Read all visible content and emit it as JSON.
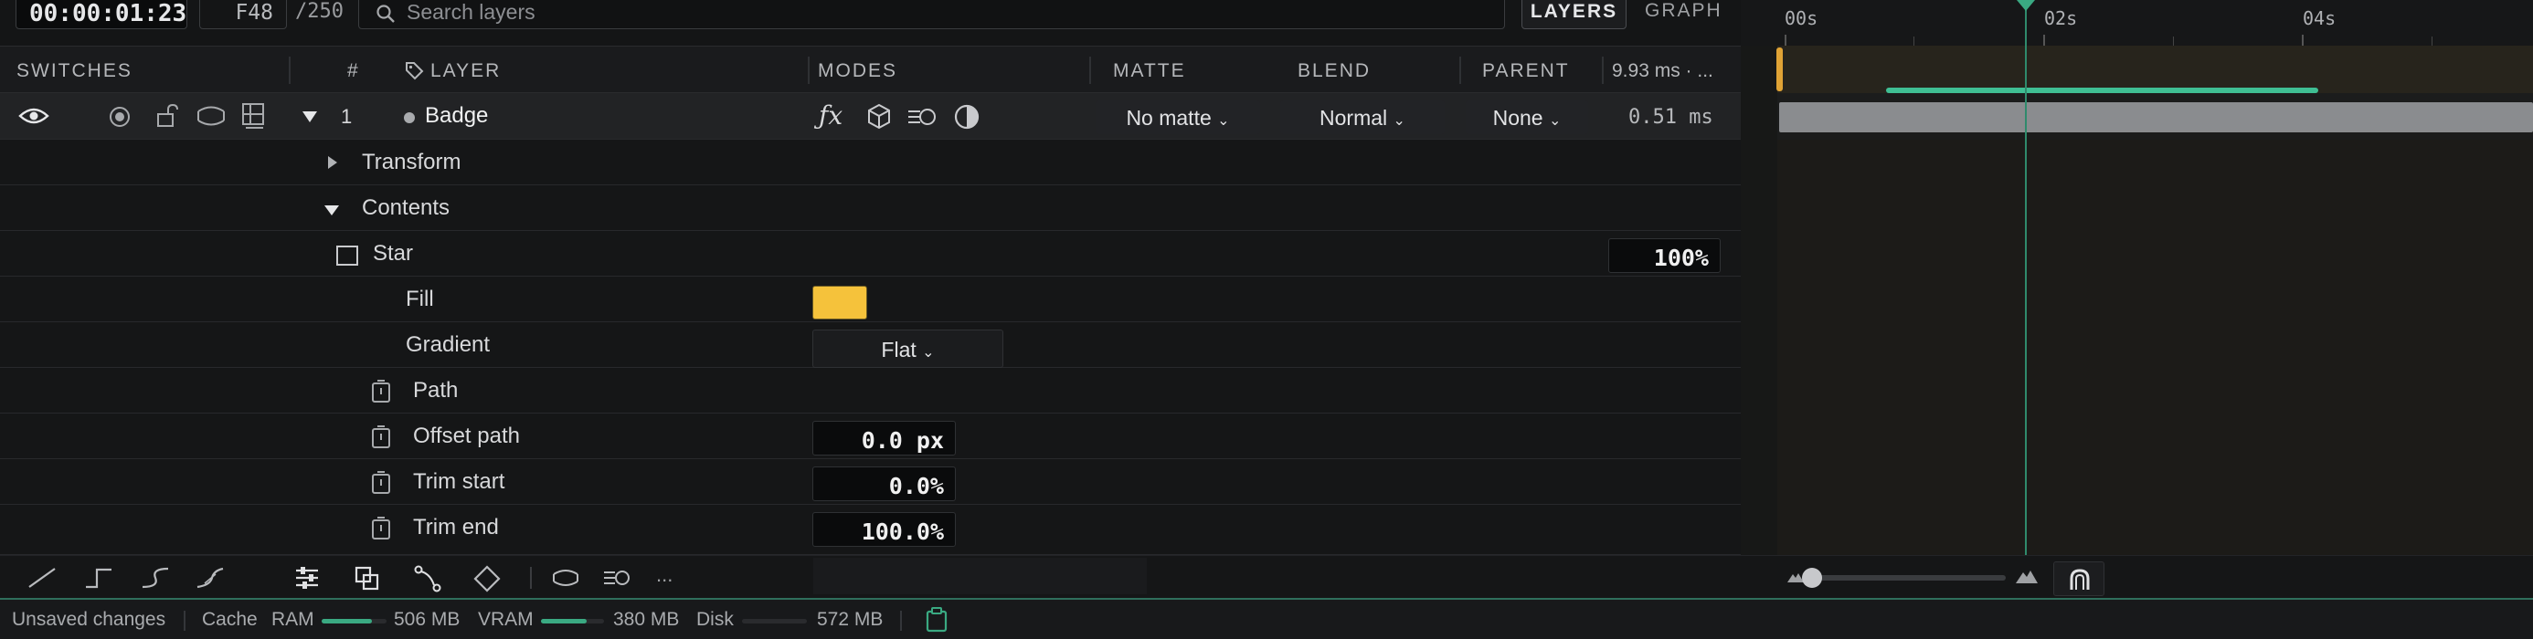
{
  "transport": {
    "timecode": "00:00:01:23",
    "frame": "F48",
    "total_frames": "/250"
  },
  "search": {
    "placeholder": "Search layers"
  },
  "view_tabs": {
    "layers": "LAYERS",
    "graph": "GRAPH"
  },
  "columns": {
    "switches": "SWITCHES",
    "index": "#",
    "layer": "LAYER",
    "modes": "MODES",
    "matte": "MATTE",
    "blend": "BLEND",
    "parent": "PARENT",
    "render_time": "9.93 ms · ..."
  },
  "layer": {
    "index": "1",
    "name": "Badge",
    "matte": "No matte",
    "blend": "Normal",
    "parent": "None",
    "time": "0.51 ms"
  },
  "props": {
    "transform": "Transform",
    "contents": "Contents",
    "star": {
      "label": "Star",
      "value": "100%"
    },
    "fill": {
      "label": "Fill",
      "color": "#f5c23b"
    },
    "gradient": {
      "label": "Gradient",
      "value": "Flat"
    },
    "path": {
      "label": "Path"
    },
    "offset_path": {
      "label": "Offset path",
      "value": "0.0 px"
    },
    "trim_start": {
      "label": "Trim start",
      "value": "0.0%"
    },
    "trim_end": {
      "label": "Trim end",
      "value": "100.0%"
    }
  },
  "timeline": {
    "ticks": [
      "00s",
      "02s",
      "04s"
    ],
    "zoom_level": 0.1
  },
  "status": {
    "unsaved": "Unsaved changes",
    "cache": "Cache",
    "ram_label": "RAM",
    "ram_value": "506 MB",
    "ram_fill": 0.78,
    "vram_label": "VRAM",
    "vram_value": "380 MB",
    "vram_fill": 0.72,
    "disk_label": "Disk",
    "disk_value": "572 MB",
    "disk_fill": 0.0
  },
  "colors": {
    "accent": "#3aa982",
    "playhead": "#2f8a6c",
    "fill_swatch": "#f5c23b",
    "keyframe": "#e0a335"
  },
  "more": "..."
}
